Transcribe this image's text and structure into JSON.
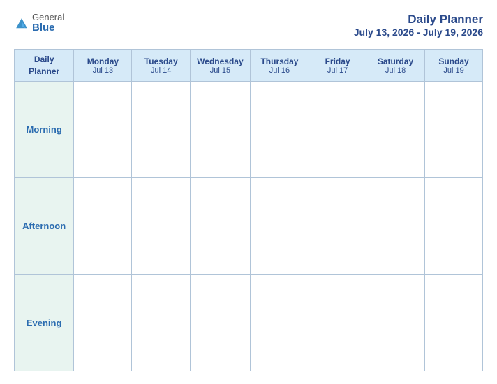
{
  "logo": {
    "general": "General",
    "blue": "Blue",
    "icon_color": "#2b6cb0"
  },
  "header": {
    "title": "Daily Planner",
    "subtitle": "July 13, 2026 - July 19, 2026"
  },
  "table": {
    "first_col_label_line1": "Daily",
    "first_col_label_line2": "Planner",
    "columns": [
      {
        "day": "Monday",
        "date": "Jul 13"
      },
      {
        "day": "Tuesday",
        "date": "Jul 14"
      },
      {
        "day": "Wednesday",
        "date": "Jul 15"
      },
      {
        "day": "Thursday",
        "date": "Jul 16"
      },
      {
        "day": "Friday",
        "date": "Jul 17"
      },
      {
        "day": "Saturday",
        "date": "Jul 18"
      },
      {
        "day": "Sunday",
        "date": "Jul 19"
      }
    ],
    "rows": [
      {
        "label": "Morning"
      },
      {
        "label": "Afternoon"
      },
      {
        "label": "Evening"
      }
    ]
  }
}
